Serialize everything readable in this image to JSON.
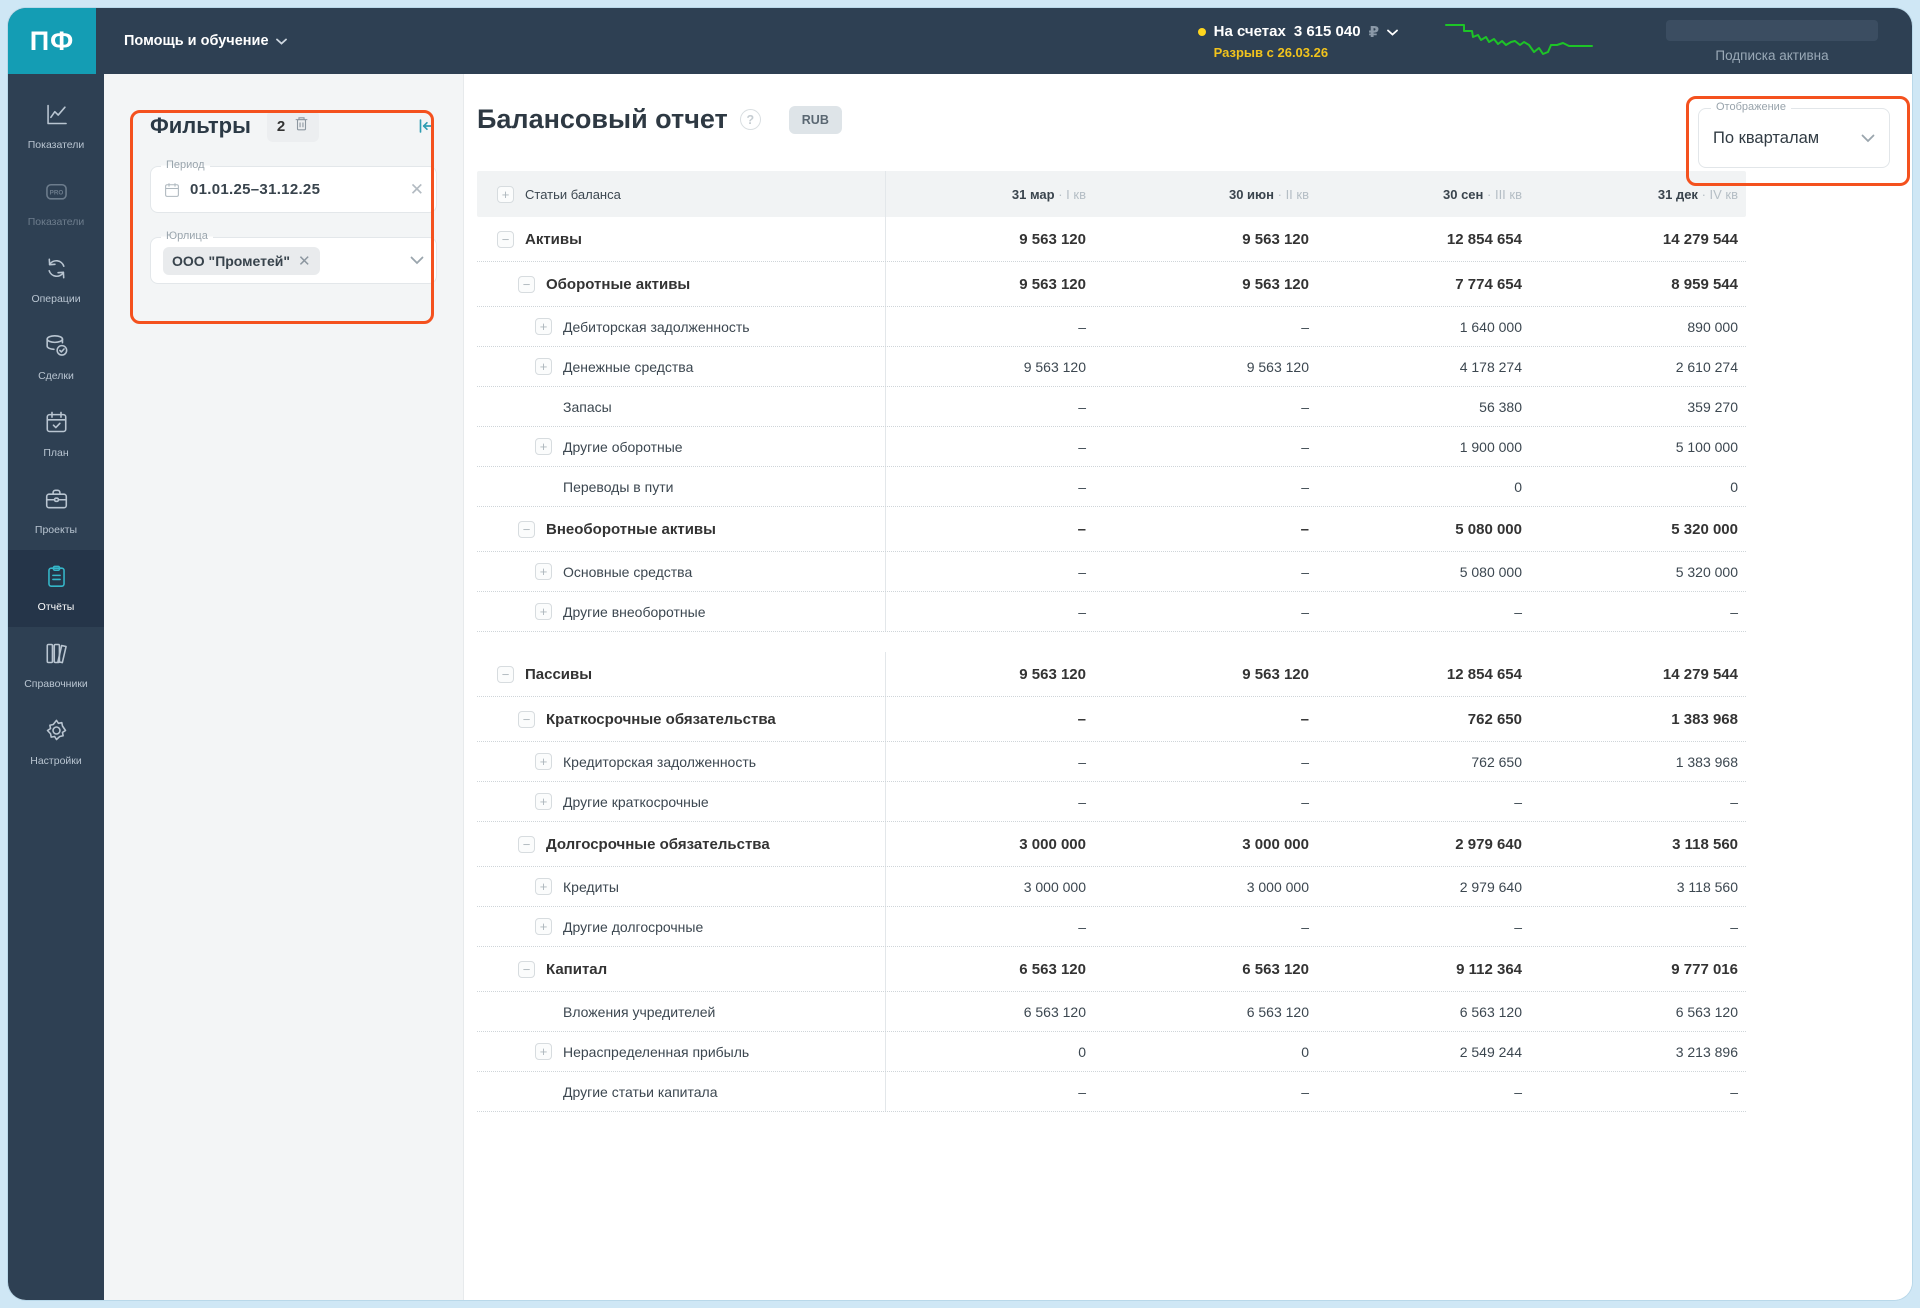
{
  "topbar": {
    "logo_text": "ПФ",
    "help_menu": "Помощь и обучение",
    "accounts_prefix": "На счетах",
    "accounts_amount": "3 615 040",
    "currency_symbol": "₽",
    "cash_gap_warning": "Разрыв с 26.03.26",
    "subscription_status": "Подписка активна"
  },
  "sidebar": {
    "items": [
      {
        "key": "indicators",
        "label": "Показатели",
        "icon": "line-chart-icon",
        "active": false,
        "dimmed": false
      },
      {
        "key": "indicators-pro",
        "label": "Показатели",
        "icon": "pro-badge-icon",
        "active": false,
        "dimmed": true
      },
      {
        "key": "operations",
        "label": "Операции",
        "icon": "sync-icon",
        "active": false,
        "dimmed": false
      },
      {
        "key": "deals",
        "label": "Сделки",
        "icon": "database-check-icon",
        "active": false,
        "dimmed": false
      },
      {
        "key": "plan",
        "label": "План",
        "icon": "calendar-check-icon",
        "active": false,
        "dimmed": false
      },
      {
        "key": "projects",
        "label": "Проекты",
        "icon": "briefcase-icon",
        "active": false,
        "dimmed": false
      },
      {
        "key": "reports",
        "label": "Отчёты",
        "icon": "clipboard-icon",
        "active": true,
        "dimmed": false
      },
      {
        "key": "handbooks",
        "label": "Справочники",
        "icon": "books-icon",
        "active": false,
        "dimmed": false
      },
      {
        "key": "settings",
        "label": "Настройки",
        "icon": "gear-icon",
        "active": false,
        "dimmed": false
      }
    ]
  },
  "filters": {
    "title": "Фильтры",
    "active_count": "2",
    "period": {
      "label": "Период",
      "value": "01.01.25–31.12.25"
    },
    "entity": {
      "label": "Юрлица",
      "chip": "ООО \"Прометей\""
    }
  },
  "report": {
    "title": "Балансовый отчет",
    "currency_badge": "RUB",
    "display": {
      "label": "Отображение",
      "value": "По кварталам"
    }
  },
  "table": {
    "first_column_header": "Статьи баланса",
    "columns": [
      {
        "date": "31 мар",
        "quarter": "I кв"
      },
      {
        "date": "30 июн",
        "quarter": "II кв"
      },
      {
        "date": "30 сен",
        "quarter": "III кв"
      },
      {
        "date": "31 дек",
        "quarter": "IV кв"
      }
    ],
    "rows": [
      {
        "label": "Активы",
        "level": 0,
        "bold": true,
        "expand": "minus",
        "gap": false,
        "values": [
          "9 563 120",
          "9 563 120",
          "12 854 654",
          "14 279 544"
        ]
      },
      {
        "label": "Оборотные активы",
        "level": 1,
        "bold": true,
        "expand": "minus",
        "gap": false,
        "values": [
          "9 563 120",
          "9 563 120",
          "7 774 654",
          "8 959 544"
        ]
      },
      {
        "label": "Дебиторская задолженность",
        "level": 2,
        "bold": false,
        "expand": "plus",
        "gap": false,
        "values": [
          "–",
          "–",
          "1 640 000",
          "890 000"
        ]
      },
      {
        "label": "Денежные средства",
        "level": 2,
        "bold": false,
        "expand": "plus",
        "gap": false,
        "values": [
          "9 563 120",
          "9 563 120",
          "4 178 274",
          "2 610 274"
        ]
      },
      {
        "label": "Запасы",
        "level": 2,
        "bold": false,
        "expand": "none",
        "gap": false,
        "values": [
          "–",
          "–",
          "56 380",
          "359 270"
        ]
      },
      {
        "label": "Другие оборотные",
        "level": 2,
        "bold": false,
        "expand": "plus",
        "gap": false,
        "values": [
          "–",
          "–",
          "1 900 000",
          "5 100 000"
        ]
      },
      {
        "label": "Переводы в пути",
        "level": 2,
        "bold": false,
        "expand": "none",
        "gap": false,
        "values": [
          "–",
          "–",
          "0",
          "0"
        ]
      },
      {
        "label": "Внеоборотные активы",
        "level": 1,
        "bold": true,
        "expand": "minus",
        "gap": false,
        "values": [
          "–",
          "–",
          "5 080 000",
          "5 320 000"
        ]
      },
      {
        "label": "Основные средства",
        "level": 2,
        "bold": false,
        "expand": "plus",
        "gap": false,
        "values": [
          "–",
          "–",
          "5 080 000",
          "5 320 000"
        ]
      },
      {
        "label": "Другие внеоборотные",
        "level": 2,
        "bold": false,
        "expand": "plus",
        "gap": false,
        "values": [
          "–",
          "–",
          "–",
          "–"
        ]
      },
      {
        "label": "Пассивы",
        "level": 0,
        "bold": true,
        "expand": "minus",
        "gap": true,
        "values": [
          "9 563 120",
          "9 563 120",
          "12 854 654",
          "14 279 544"
        ]
      },
      {
        "label": "Краткосрочные обязательства",
        "level": 1,
        "bold": true,
        "expand": "minus",
        "gap": false,
        "values": [
          "–",
          "–",
          "762 650",
          "1 383 968"
        ]
      },
      {
        "label": "Кредиторская задолженность",
        "level": 2,
        "bold": false,
        "expand": "plus",
        "gap": false,
        "values": [
          "–",
          "–",
          "762 650",
          "1 383 968"
        ]
      },
      {
        "label": "Другие краткосрочные",
        "level": 2,
        "bold": false,
        "expand": "plus",
        "gap": false,
        "values": [
          "–",
          "–",
          "–",
          "–"
        ]
      },
      {
        "label": "Долгосрочные обязательства",
        "level": 1,
        "bold": true,
        "expand": "minus",
        "gap": false,
        "values": [
          "3 000 000",
          "3 000 000",
          "2 979 640",
          "3 118 560"
        ]
      },
      {
        "label": "Кредиты",
        "level": 2,
        "bold": false,
        "expand": "plus",
        "gap": false,
        "values": [
          "3 000 000",
          "3 000 000",
          "2 979 640",
          "3 118 560"
        ]
      },
      {
        "label": "Другие долгосрочные",
        "level": 2,
        "bold": false,
        "expand": "plus",
        "gap": false,
        "values": [
          "–",
          "–",
          "–",
          "–"
        ]
      },
      {
        "label": "Капитал",
        "level": 1,
        "bold": true,
        "expand": "minus",
        "gap": false,
        "values": [
          "6 563 120",
          "6 563 120",
          "9 112 364",
          "9 777 016"
        ]
      },
      {
        "label": "Вложения учредителей",
        "level": 2,
        "bold": false,
        "expand": "none",
        "gap": false,
        "values": [
          "6 563 120",
          "6 563 120",
          "6 563 120",
          "6 563 120"
        ]
      },
      {
        "label": "Нераспределенная прибыль",
        "level": 2,
        "bold": false,
        "expand": "plus",
        "gap": false,
        "values": [
          "0",
          "0",
          "2 549 244",
          "3 213 896"
        ]
      },
      {
        "label": "Другие статьи капитала",
        "level": 2,
        "bold": false,
        "expand": "none",
        "gap": false,
        "values": [
          "–",
          "–",
          "–",
          "–"
        ]
      }
    ]
  },
  "colors": {
    "topbar_navy": "#2e4053",
    "accent_teal": "#149db4",
    "active_icon_teal": "#35b6c9",
    "warning_yellow": "#f2c31c",
    "sparkline_green": "#1dc427",
    "annotation_orange": "#f4511e"
  }
}
